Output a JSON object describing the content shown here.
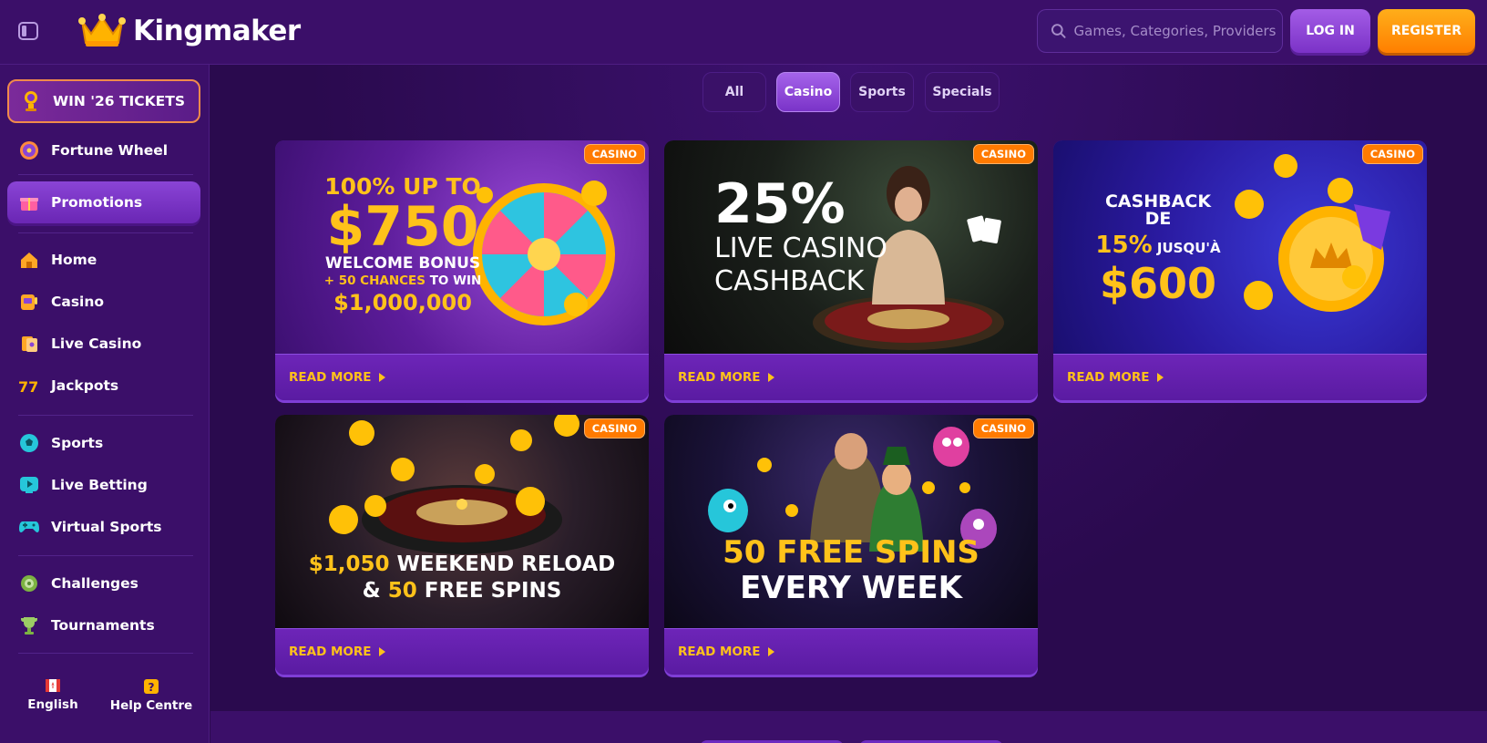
{
  "header": {
    "brand": "Kingmaker",
    "search_placeholder": "Games, Categories, Providers",
    "login_label": "LOG IN",
    "register_label": "REGISTER"
  },
  "sidebar": {
    "items": [
      {
        "label": "WIN '26 TICKETS",
        "icon": "trophy-icon"
      },
      {
        "label": "Fortune Wheel",
        "icon": "wheel-icon"
      },
      {
        "label": "Promotions",
        "icon": "gift-icon"
      },
      {
        "label": "Home",
        "icon": "home-icon"
      },
      {
        "label": "Casino",
        "icon": "casino-icon"
      },
      {
        "label": "Live Casino",
        "icon": "cards-icon"
      },
      {
        "label": "Jackpots",
        "icon": "jackpot-icon"
      },
      {
        "label": "Sports",
        "icon": "soccer-ball-icon"
      },
      {
        "label": "Live Betting",
        "icon": "play-icon"
      },
      {
        "label": "Virtual Sports",
        "icon": "gamepad-icon"
      },
      {
        "label": "Challenges",
        "icon": "medal-icon"
      },
      {
        "label": "Tournaments",
        "icon": "trophy-cup-icon"
      }
    ],
    "language_label": "English",
    "help_label": "Help Centre"
  },
  "tabs": [
    {
      "label": "All"
    },
    {
      "label": "Casino"
    },
    {
      "label": "Sports"
    },
    {
      "label": "Specials"
    }
  ],
  "cards": [
    {
      "badge": "CASINO",
      "cta": "READ MORE",
      "line1": "100% UP TO",
      "line2": "$750",
      "line3": "WELCOME BONUS",
      "line4a": "+ 50 CHANCES",
      "line4b": " TO WIN",
      "line5": "$1,000,000"
    },
    {
      "badge": "CASINO",
      "cta": "READ MORE",
      "line1": "25%",
      "line2": "LIVE CASINO",
      "line3": "CASHBACK"
    },
    {
      "badge": "CASINO",
      "cta": "READ MORE",
      "line1": "CASHBACK DE",
      "line2a": "15%",
      "line2b": " JUSQU'À",
      "line3": "$600"
    },
    {
      "badge": "CASINO",
      "cta": "READ MORE",
      "line1a": "$1,050",
      "line1b": " WEEKEND RELOAD",
      "line2a": "& ",
      "line2b": "50",
      "line2c": " FREE SPINS"
    },
    {
      "badge": "CASINO",
      "cta": "READ MORE",
      "line1": "50 FREE SPINS",
      "line2": "EVERY WEEK"
    }
  ],
  "colors": {
    "accent_orange": "#ff7a00",
    "accent_yellow": "#ffc21a",
    "primary_purple": "#7a33c8",
    "background": "#2a0a4e"
  }
}
